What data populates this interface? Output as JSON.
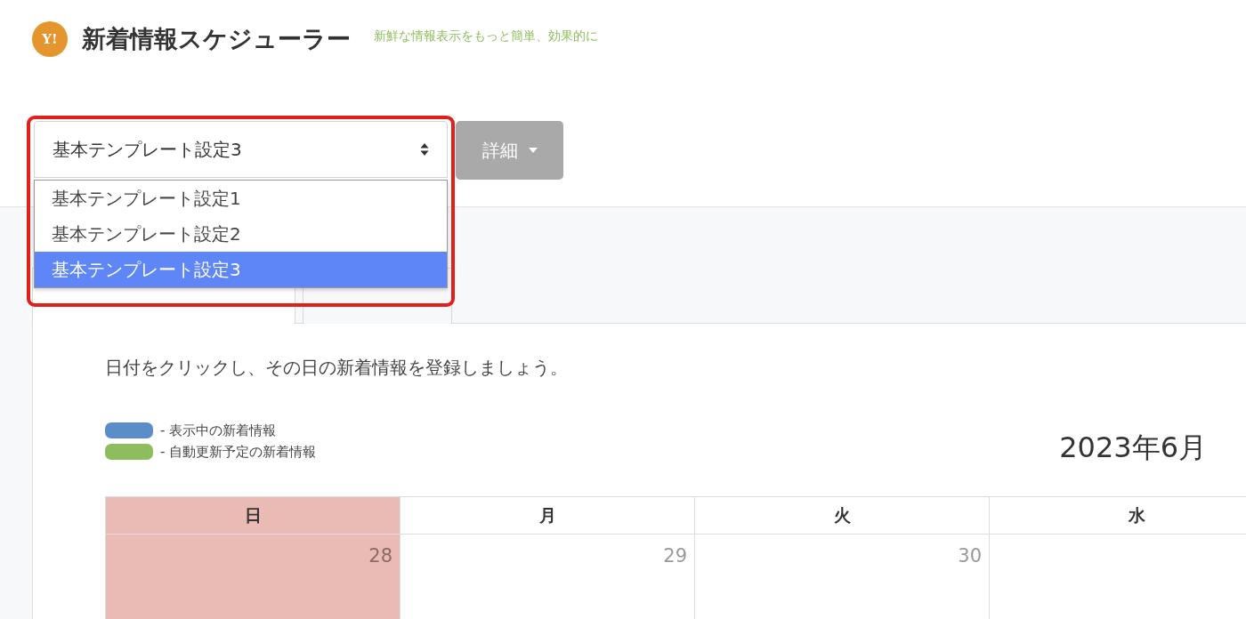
{
  "header": {
    "logo": "Y!",
    "title": "新着情報スケジューラー",
    "tagline": "新鮮な情報表示をもっと簡単、効果的に"
  },
  "template_select": {
    "value": "基本テンプレート設定3",
    "expanded": true,
    "options": [
      {
        "label": "基本テンプレート設定1",
        "selected": false
      },
      {
        "label": "基本テンプレート設定2",
        "selected": false
      },
      {
        "label": "基本テンプレート設定3",
        "selected": true
      }
    ]
  },
  "details_button": {
    "label": "詳細"
  },
  "instruction": "日付をクリックし、その日の新着情報を登録しましょう。",
  "legend": [
    {
      "label": "- 表示中の新着情報",
      "color": "#5b8ec9"
    },
    {
      "label": "- 自動更新予定の新着情報",
      "color": "#8dbd5c"
    }
  ],
  "calendar": {
    "title": "2023年6月",
    "weekdays": [
      {
        "label": "日",
        "kind": "sunday"
      },
      {
        "label": "月",
        "kind": "weekday"
      },
      {
        "label": "火",
        "kind": "weekday"
      },
      {
        "label": "水",
        "kind": "weekday"
      }
    ],
    "days": [
      {
        "label": "28",
        "kind": "sunday"
      },
      {
        "label": "29",
        "kind": "weekday"
      },
      {
        "label": "30",
        "kind": "weekday"
      },
      {
        "kind": "weekday"
      }
    ]
  }
}
